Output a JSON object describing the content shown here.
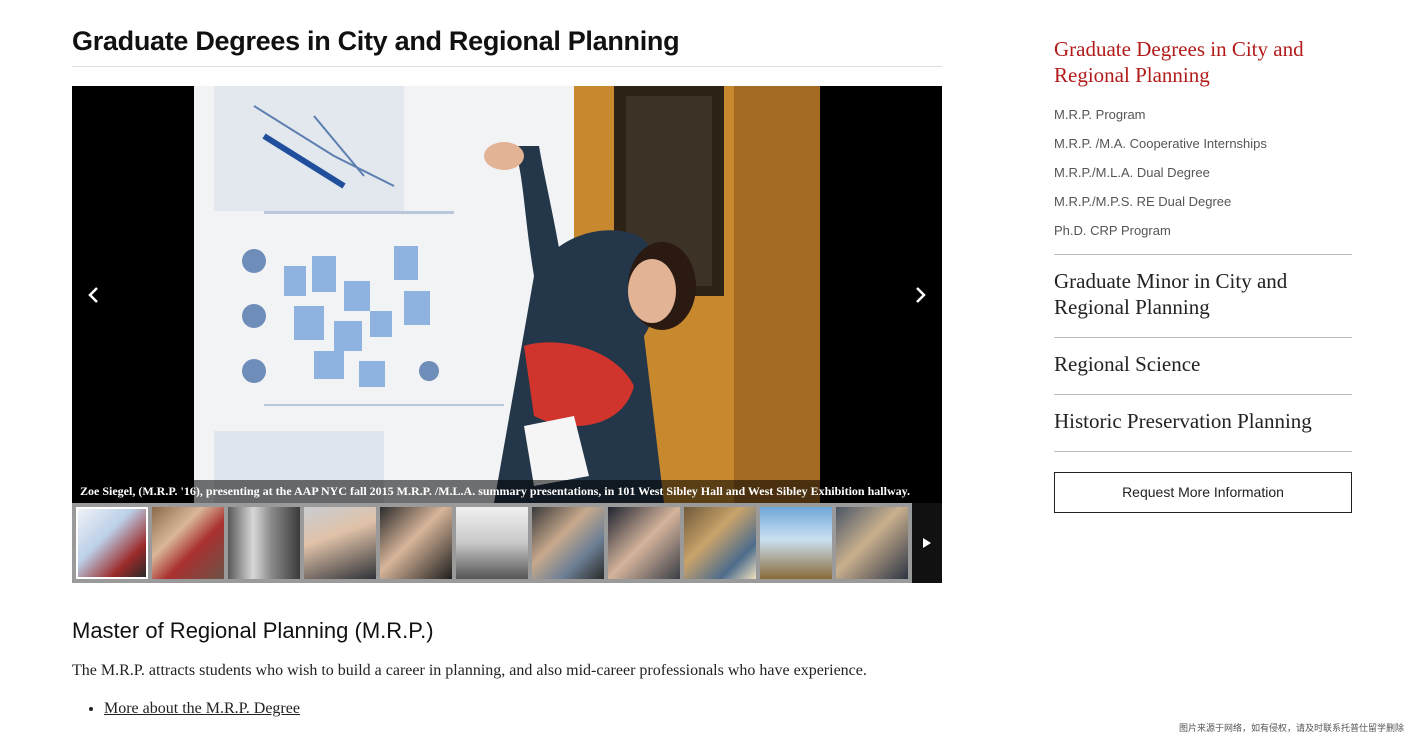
{
  "page": {
    "title": "Graduate Degrees in City and Regional Planning"
  },
  "slideshow": {
    "caption": "Zoe Siegel, (M.R.P. '16), presenting at the AAP NYC fall 2015 M.R.P. /M.L.A. summary presentations, in 101 West Sibley Hall and West Sibley Exhibition hallway.",
    "prev_icon": "chevron-left-icon",
    "next_icon": "chevron-right-icon",
    "thumbnail_count": 12,
    "active_thumbnail": 1
  },
  "section": {
    "heading": "Master of Regional Planning (M.R.P.)",
    "text": "The M.R.P. attracts students who wish to build a career in planning, and also mid-career professionals who have experience.",
    "links": [
      {
        "label": "More about the M.R.P. Degree"
      }
    ]
  },
  "sidebar": {
    "current": "Graduate Degrees in City and Regional Planning",
    "subitems": [
      {
        "label": "M.R.P. Program"
      },
      {
        "label": "M.R.P. /M.A. Cooperative Internships"
      },
      {
        "label": "M.R.P./M.L.A. Dual Degree"
      },
      {
        "label": "M.R.P./M.P.S. RE Dual Degree"
      },
      {
        "label": "Ph.D. CRP Program"
      }
    ],
    "links": [
      {
        "label": "Graduate Minor in City and Regional Planning"
      },
      {
        "label": "Regional Science"
      },
      {
        "label": "Historic Preservation Planning"
      }
    ],
    "request_button": "Request More Information",
    "accent_color": "#b31b1b"
  },
  "watermark": "图片来源于网络，如有侵权，请及时联系托普仕留学删除"
}
